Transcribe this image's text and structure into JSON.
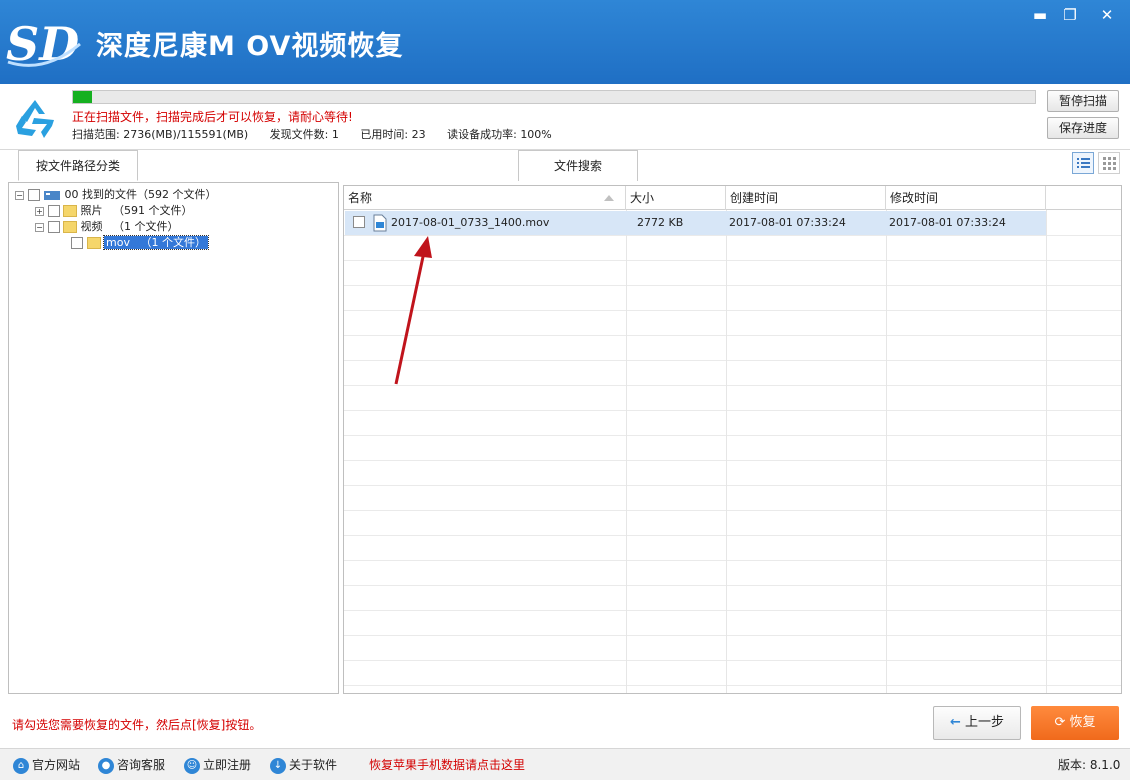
{
  "window": {
    "title": "深度尼康M OV视频恢复",
    "minimize_glyph": "▬",
    "restore_glyph": "❐",
    "close_glyph": "✕"
  },
  "scan": {
    "progress": 0.02,
    "status": "正在扫描文件，扫描完成后才可以恢复，请耐心等待!",
    "range_label": "扫描范围:",
    "range_value": "2736(MB)/115591(MB)",
    "found_label": "发现文件数:",
    "found_value": "1",
    "time_label": "已用时间:",
    "time_value": "23",
    "rate_label": "读设备成功率:",
    "rate_value": "100%",
    "pause_button": "暂停扫描",
    "save_button": "保存进度"
  },
  "tabs": {
    "by_path": "按文件路径分类",
    "search": "文件搜索"
  },
  "tree": {
    "root": "00 找到的文件（592 个文件）",
    "photos": "照片",
    "photos_count": "（591 个文件）",
    "videos": "视频",
    "videos_count": "（1 个文件）",
    "mov": "mov",
    "mov_count": "（1 个文件）"
  },
  "list": {
    "columns": [
      "名称",
      "大小",
      "创建时间",
      "修改时间"
    ],
    "rows": [
      {
        "name": "2017-08-01_0733_1400.mov",
        "size": "2772 KB",
        "created": "2017-08-01  07:33:24",
        "modified": "2017-08-01  07:33:24"
      }
    ]
  },
  "bottom": {
    "hint": "请勾选您需要恢复的文件，然后点[恢复]按钮。",
    "prev_button": "上一步",
    "recover_button": "恢复"
  },
  "footer": {
    "official_site": "官方网站",
    "support": "咨询客服",
    "register": "立即注册",
    "about": "关于软件",
    "apple_link": "恢复苹果手机数据请点击这里",
    "version": "版本: 8.1.0"
  },
  "colors": {
    "title_bar": "#2f86d6",
    "progress": "#15b020",
    "warning_text": "#d40000",
    "recover_button": "#f06a1c",
    "selected_row": "#d7e6f7"
  }
}
